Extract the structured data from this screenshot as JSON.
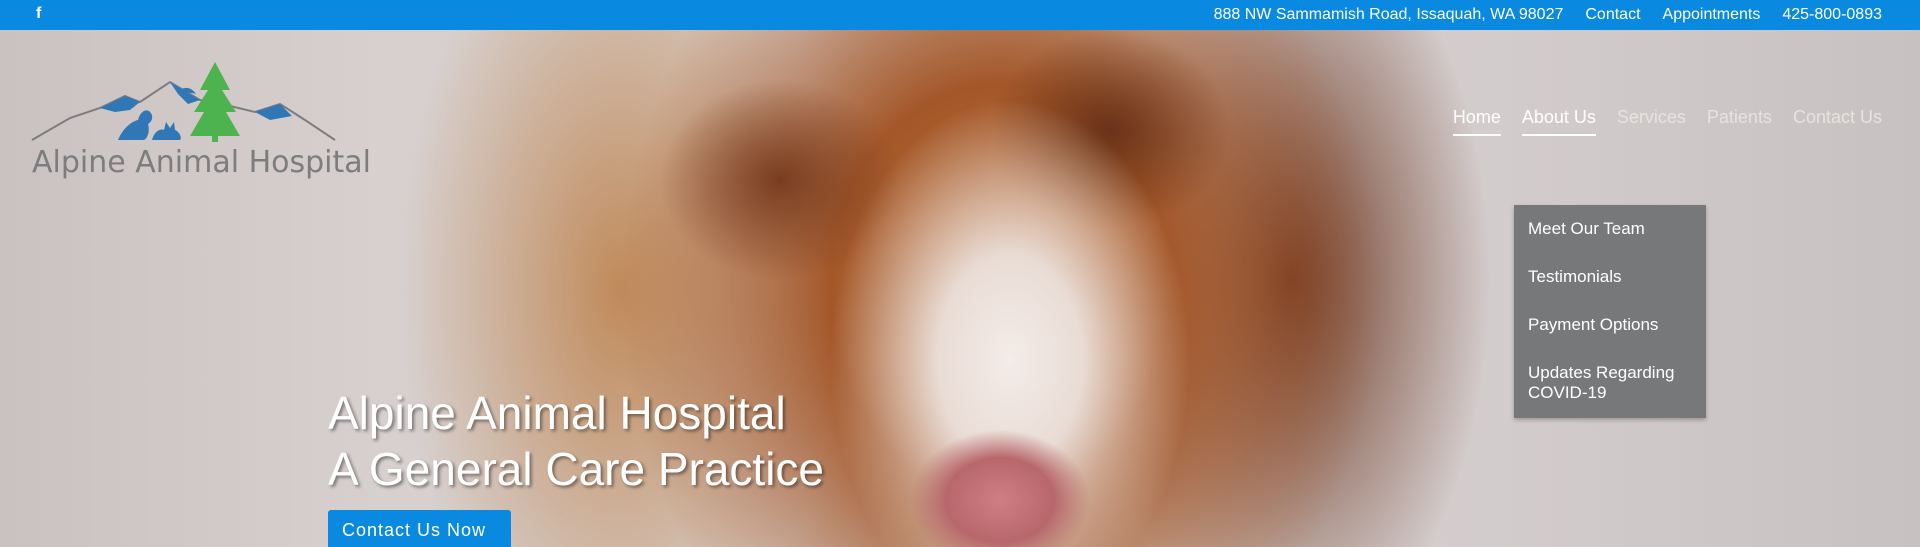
{
  "colors": {
    "accent": "#0a89e0",
    "dropdown_bg": "#77787a",
    "logo_text": "#7d7d80",
    "logo_blue": "#2f78b5",
    "logo_green": "#4cb34f"
  },
  "topbar": {
    "facebook_icon": "facebook-icon",
    "address": "888 NW Sammamish Road, Issaquah, WA 98027",
    "contact": "Contact",
    "appointments": "Appointments",
    "phone": "425-800-0893"
  },
  "logo": {
    "text": "Alpine Animal Hospital"
  },
  "nav": {
    "items": [
      {
        "label": "Home"
      },
      {
        "label": "About Us"
      },
      {
        "label": "Services"
      },
      {
        "label": "Patients"
      },
      {
        "label": "Contact Us"
      }
    ]
  },
  "about_dropdown": {
    "items": [
      {
        "label": "Meet Our Team"
      },
      {
        "label": "Testimonials"
      },
      {
        "label": "Payment Options"
      },
      {
        "label": "Updates Regarding COVID-19"
      }
    ]
  },
  "hero": {
    "line1": "Alpine Animal Hospital",
    "line2": "A General Care Practice",
    "cta": "Contact Us Now"
  }
}
